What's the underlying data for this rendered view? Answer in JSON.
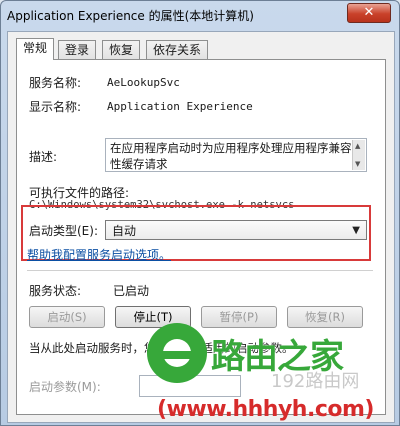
{
  "window": {
    "title": "Application Experience 的属性(本地计算机)",
    "close_glyph": "✕"
  },
  "tabs": [
    {
      "label": "常规",
      "active": true
    },
    {
      "label": "登录",
      "active": false
    },
    {
      "label": "恢复",
      "active": false
    },
    {
      "label": "依存关系",
      "active": false
    }
  ],
  "general": {
    "service_name_label": "服务名称:",
    "service_name_value": "AeLookupSvc",
    "display_name_label": "显示名称:",
    "display_name_value": "Application Experience",
    "description_label": "描述:",
    "description_value": "在应用程序启动时为应用程序处理应用程序兼容性缓存请求",
    "exe_path_label": "可执行文件的路径:",
    "exe_path_value": "C:\\Windows\\system32\\svchost.exe -k netsvcs",
    "startup_type_label": "启动类型(E):",
    "startup_type_value": "自动",
    "help_link": "帮助我配置服务启动选项。",
    "service_status_label": "服务状态:",
    "service_status_value": "已启动",
    "buttons": {
      "start": "启动(S)",
      "stop": "停止(T)",
      "pause": "暂停(P)",
      "resume": "恢复(R)"
    },
    "hint": "当从此处启动服务时，您可指定所适用的启动参数。",
    "start_params_label": "启动参数(M):",
    "start_params_value": ""
  },
  "watermark": {
    "title": "路由之家",
    "subtitle": "192路由网",
    "url": "(www.hhhyh.com)"
  },
  "colors": {
    "highlight_border": "#d83a3a",
    "link": "#0b4fa3",
    "watermark_green": "#37a83a",
    "watermark_red": "#d62b2b"
  }
}
